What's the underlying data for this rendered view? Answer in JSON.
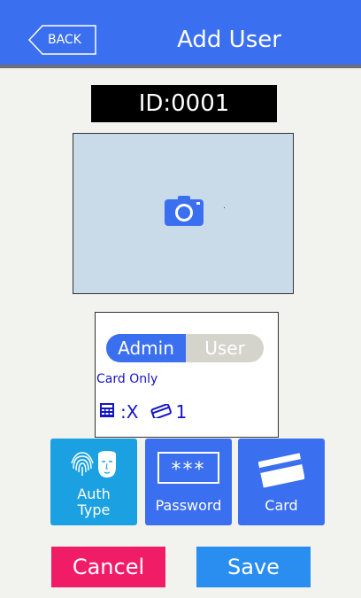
{
  "header": {
    "back_label": "BACK",
    "title": "Add User"
  },
  "user": {
    "id_label": "ID:0001"
  },
  "photo": {
    "icon": "camera-icon"
  },
  "role_toggle": {
    "options": [
      "Admin",
      "User"
    ],
    "selected": "Admin"
  },
  "auth_summary": {
    "mode_text": "Card Only",
    "password_count": ":X",
    "card_count": "1",
    "password_icon": "keypad-icon",
    "card_icon": "card-icon"
  },
  "tiles": [
    {
      "label": "Auth\nType",
      "icon": "fingerprint-face-icon"
    },
    {
      "label": "Password",
      "icon": "password-icon"
    },
    {
      "label": "Card",
      "icon": "card-icon"
    }
  ],
  "actions": {
    "cancel_label": "Cancel",
    "save_label": "Save"
  },
  "colors": {
    "header": "#3a6ff0",
    "admin_active": "#3a6ff0",
    "auth_tile": "#1ba1e2",
    "cancel": "#f01c66",
    "save": "#2a8df0",
    "info_text": "#1414c8"
  }
}
